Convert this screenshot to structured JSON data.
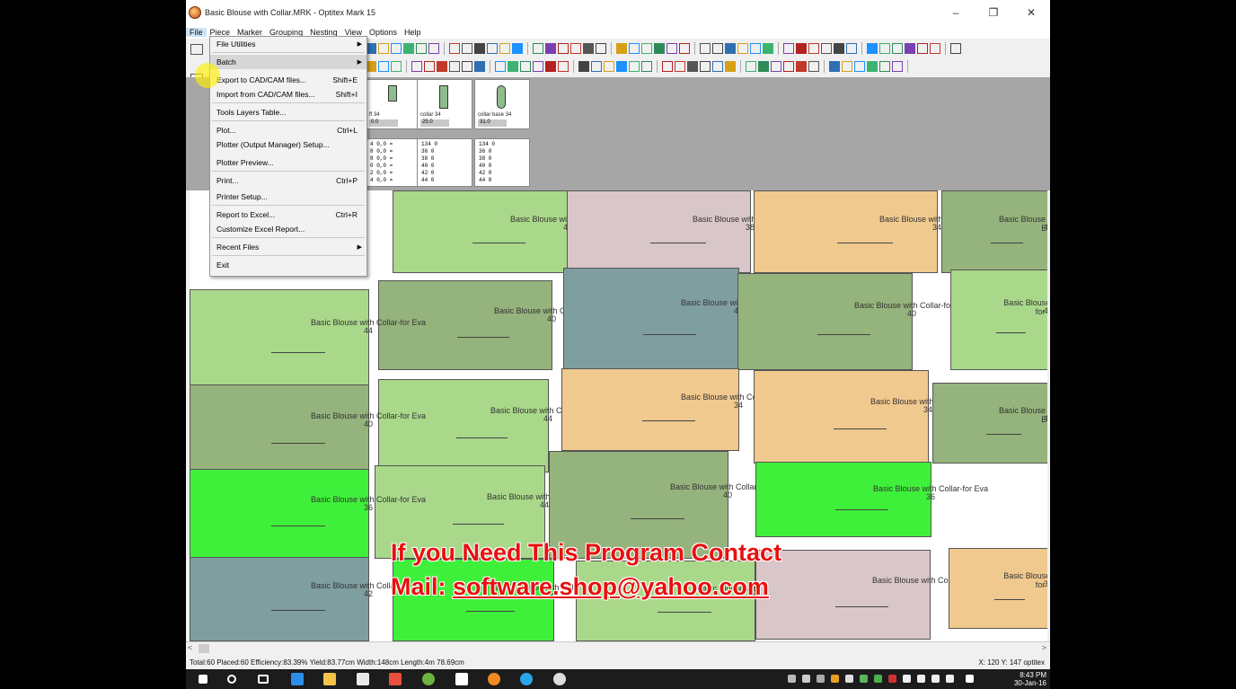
{
  "window": {
    "title": "Basic Blouse with Collar.MRK - Optitex Mark 15",
    "minimize": "–",
    "maximize": "❐",
    "close": "✕"
  },
  "menubar": [
    "File",
    "Piece",
    "Marker",
    "Grouping",
    "Nesting",
    "View",
    "Options",
    "Help"
  ],
  "file_menu": [
    {
      "label": "File Utilities",
      "shortcut": "",
      "submenu": true
    },
    {
      "label": "Batch",
      "shortcut": "",
      "submenu": true
    },
    {
      "label": "Export to CAD/CAM files...",
      "shortcut": "Shift+E",
      "submenu": false
    },
    {
      "label": "Import from CAD/CAM files...",
      "shortcut": "Shift+I",
      "submenu": false
    },
    {
      "label": "Tools Layers Table...",
      "shortcut": "",
      "submenu": false
    },
    {
      "label": "Plot...",
      "shortcut": "Ctrl+L",
      "submenu": false
    },
    {
      "label": "Plotter (Output Manager) Setup...",
      "shortcut": "",
      "submenu": false
    },
    {
      "label": "Plotter Preview...",
      "shortcut": "",
      "submenu": false
    },
    {
      "label": "Print...",
      "shortcut": "Ctrl+P",
      "submenu": false
    },
    {
      "label": "Printer Setup...",
      "shortcut": "",
      "submenu": false
    },
    {
      "label": "Report to Excel...",
      "shortcut": "Ctrl+R",
      "submenu": false
    },
    {
      "label": "Customize Excel Report...",
      "shortcut": "",
      "submenu": false
    },
    {
      "label": "Recent Files",
      "shortcut": "",
      "submenu": true
    },
    {
      "label": "Exit",
      "shortcut": "",
      "submenu": false
    }
  ],
  "piece_cards": [
    {
      "label": "ff 34",
      "value": "0.0",
      "extra": "="
    },
    {
      "label": "collar 34",
      "value": "25.0",
      "extra": ""
    },
    {
      "label": "collar base 34",
      "value": "31.0",
      "extra": ""
    }
  ],
  "size_tables": [
    [
      "4  0,0 =",
      "8  0,0 =",
      "8  0,0 =",
      "0  0,0 =",
      "2  0,0 =",
      "4  0,0 ="
    ],
    [
      "134  0",
      "36  0",
      "38  0",
      "40  0",
      "42  0",
      "44  0"
    ],
    [
      "134  0",
      "36  0",
      "38  0",
      "40  0",
      "42  0",
      "44  0"
    ]
  ],
  "piece_name": "Basic Blouse with Collar-for Eva",
  "pieces": [
    {
      "size": "44",
      "color": "#a9d88a"
    },
    {
      "size": "38",
      "color": "#d9c6c9"
    },
    {
      "size": "34",
      "color": "#f0c98e"
    },
    {
      "size": "40",
      "color": "#95b37c"
    },
    {
      "size": "40",
      "color": "#95b37c"
    },
    {
      "size": "42",
      "color": "#7f9ea0"
    },
    {
      "size": "40",
      "color": "#95b37c"
    },
    {
      "size": "44",
      "color": "#a9d88a"
    },
    {
      "size": "44",
      "color": "#a9d88a"
    },
    {
      "size": "44",
      "color": "#a9d88a"
    },
    {
      "size": "34",
      "color": "#f0c98e"
    },
    {
      "size": "34",
      "color": "#f0c98e"
    },
    {
      "size": "40",
      "color": "#95b37c"
    },
    {
      "size": "40",
      "color": "#95b37c"
    },
    {
      "size": "44",
      "color": "#a9d88a"
    },
    {
      "size": "40",
      "color": "#95b37c"
    },
    {
      "size": "36",
      "color": "#3ff03a"
    },
    {
      "size": "36",
      "color": "#3ff03a"
    },
    {
      "size": "42",
      "color": "#7f9ea0"
    },
    {
      "size": "36",
      "color": "#3ff03a"
    },
    {
      "size": "44",
      "color": "#a9d88a"
    },
    {
      "size": "",
      "color": "#d9c6c9"
    },
    {
      "size": "34",
      "color": "#f0c98e"
    }
  ],
  "overlay": {
    "line1": "If you Need This Program Contact",
    "line2_prefix": "Mail:  ",
    "line2_email": "software.shop@yahoo.com"
  },
  "status": {
    "left": "Total:60 Placed:60 Efficiency:83.39% Yield:83.77cm Width:148cm Length:4m 78.69cm",
    "right": "X: 120  Y: 147  optitex"
  },
  "clock": {
    "time": "8:43 PM",
    "date": "30-Jan-16"
  },
  "colors": {
    "accent": "#e81010",
    "canvas": "#ffffff",
    "strip": "#a6a6a6"
  }
}
